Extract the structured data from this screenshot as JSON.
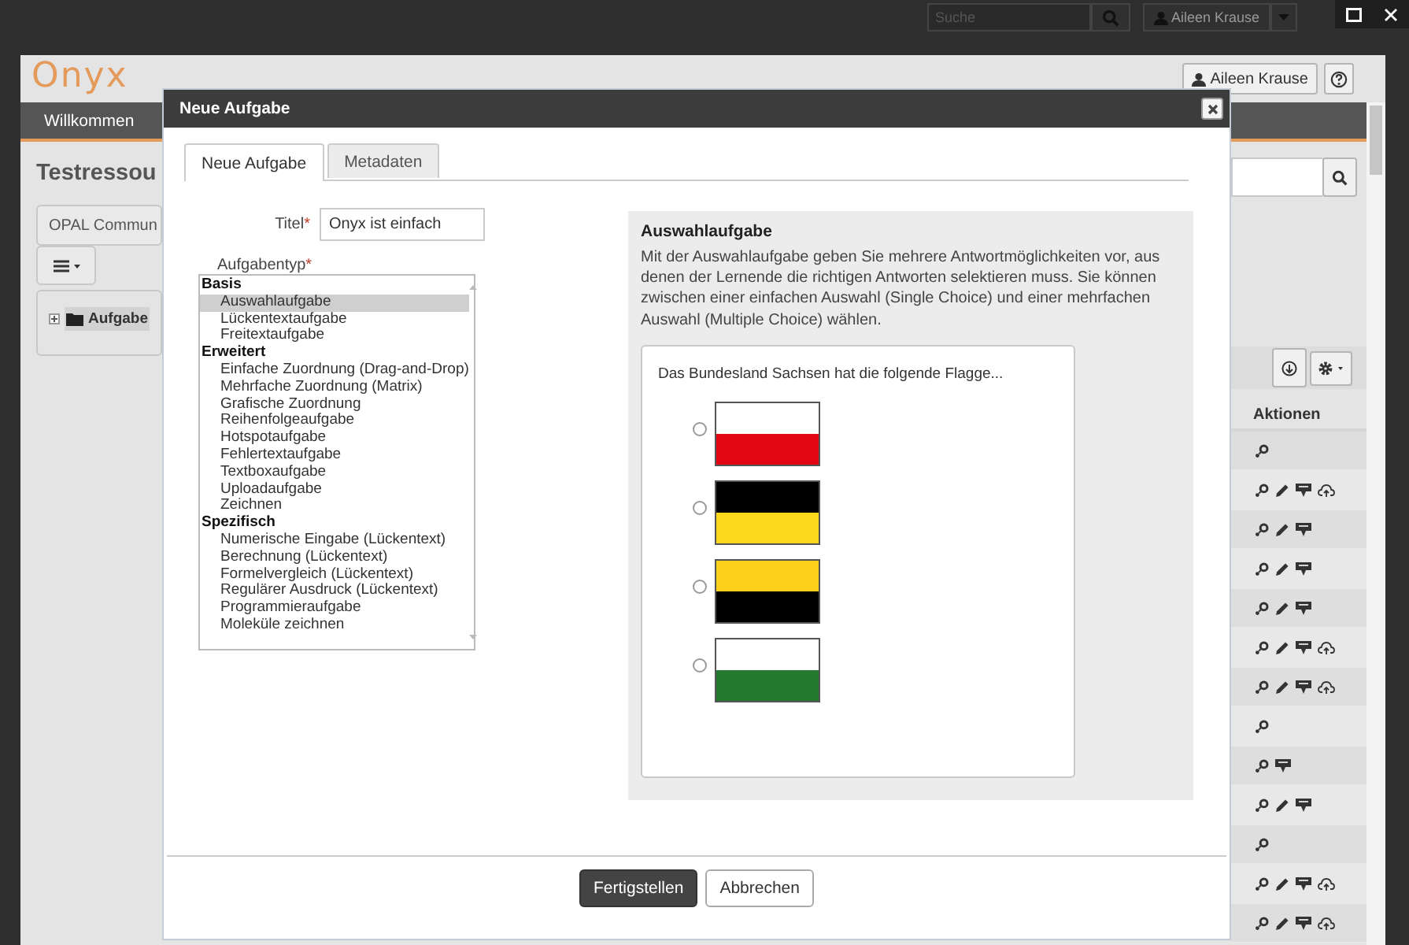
{
  "page_header": {
    "search": {
      "placeholder": "Suche"
    },
    "user": "Aileen Krause"
  },
  "app_window": {
    "logo": "Onyx",
    "user": "Aileen Krause",
    "nav": [
      {
        "label": "Willkommen",
        "selected": true
      }
    ],
    "page_title": "Testressou",
    "breadcrumb": "OPAL Commun",
    "tree": [
      {
        "label": "Aufgabe",
        "expanded": false,
        "selected": true
      }
    ],
    "table": {
      "columns": [
        "Aktionen"
      ],
      "rows": [
        {
          "edit": false,
          "comment": false,
          "upload": false
        },
        {
          "edit": true,
          "comment": true,
          "upload": true
        },
        {
          "edit": true,
          "comment": true,
          "upload": false
        },
        {
          "edit": true,
          "comment": true,
          "upload": false
        },
        {
          "edit": true,
          "comment": true,
          "upload": false
        },
        {
          "edit": true,
          "comment": true,
          "upload": true
        },
        {
          "edit": true,
          "comment": true,
          "upload": true
        },
        {
          "edit": false,
          "comment": false,
          "upload": false
        },
        {
          "edit": false,
          "comment": true,
          "upload": false
        },
        {
          "edit": true,
          "comment": true,
          "upload": false
        },
        {
          "edit": false,
          "comment": false,
          "upload": false
        },
        {
          "edit": true,
          "comment": true,
          "upload": true
        },
        {
          "edit": true,
          "comment": true,
          "upload": true
        }
      ]
    }
  },
  "dialog": {
    "title": "Neue Aufgabe",
    "tabs": [
      {
        "label": "Neue Aufgabe",
        "selected": true
      },
      {
        "label": "Metadaten",
        "selected": false
      }
    ],
    "title_field": {
      "label": "Titel",
      "mark": "*",
      "value": "Onyx ist einfach"
    },
    "task_type": {
      "label": "Aufgabentyp",
      "mark": "*",
      "groups": [
        {
          "label": "Basis",
          "children": [
            {
              "label": "Auswahlaufgabe",
              "selected": true
            },
            {
              "label": "Lückentextaufgabe",
              "selected": false
            },
            {
              "label": "Freitextaufgabe",
              "selected": false
            }
          ]
        },
        {
          "label": "Erweitert",
          "children": [
            {
              "label": "Einfache Zuordnung (Drag-and-Drop)",
              "selected": false
            },
            {
              "label": "Mehrfache Zuordnung (Matrix)",
              "selected": false
            },
            {
              "label": "Grafische Zuordnung",
              "selected": false
            },
            {
              "label": "Reihenfolgeaufgabe",
              "selected": false
            },
            {
              "label": "Hotspotaufgabe",
              "selected": false
            },
            {
              "label": "Fehlertextaufgabe",
              "selected": false
            },
            {
              "label": "Textboxaufgabe",
              "selected": false
            },
            {
              "label": "Uploadaufgabe",
              "selected": false
            },
            {
              "label": "Zeichnen",
              "selected": false
            }
          ]
        },
        {
          "label": "Spezifisch",
          "children": [
            {
              "label": "Numerische Eingabe (Lückentext)",
              "selected": false
            },
            {
              "label": "Berechnung (Lückentext)",
              "selected": false
            },
            {
              "label": "Formelvergleich (Lückentext)",
              "selected": false
            },
            {
              "label": "Regulärer Ausdruck (Lückentext)",
              "selected": false
            },
            {
              "label": "Programmieraufgabe",
              "selected": false
            },
            {
              "label": "Moleküle zeichnen",
              "selected": false
            }
          ]
        }
      ]
    },
    "preview": {
      "title": "Auswahlaufgabe",
      "description": "Mit der Auswahlaufgabe geben Sie mehrere Antwortmöglichkeiten vor, aus denen der Lernende die richtigen Antworten selektieren muss. Sie können zwischen einer einfachen Auswahl (Single Choice) und einer mehrfachen Auswahl (Multiple Choice) wählen.",
      "question": "Das Bundesland Sachsen hat die folgende Flagge...",
      "options": [
        {
          "selected": false,
          "stripes": [
            {
              "color": "#ffffff"
            },
            {
              "color": "#e30613"
            }
          ]
        },
        {
          "selected": false,
          "stripes": [
            {
              "color": "#000000"
            },
            {
              "color": "#fcd91c"
            }
          ]
        },
        {
          "selected": false,
          "stripes": [
            {
              "color": "#fcd01c"
            },
            {
              "color": "#000000"
            }
          ]
        },
        {
          "selected": false,
          "stripes": [
            {
              "color": "#ffffff"
            },
            {
              "color": "#23792f"
            }
          ]
        }
      ]
    },
    "buttons": [
      {
        "label": "Fertigstellen",
        "kind": "primary"
      },
      {
        "label": "Abbrechen",
        "kind": "secondary"
      }
    ]
  }
}
